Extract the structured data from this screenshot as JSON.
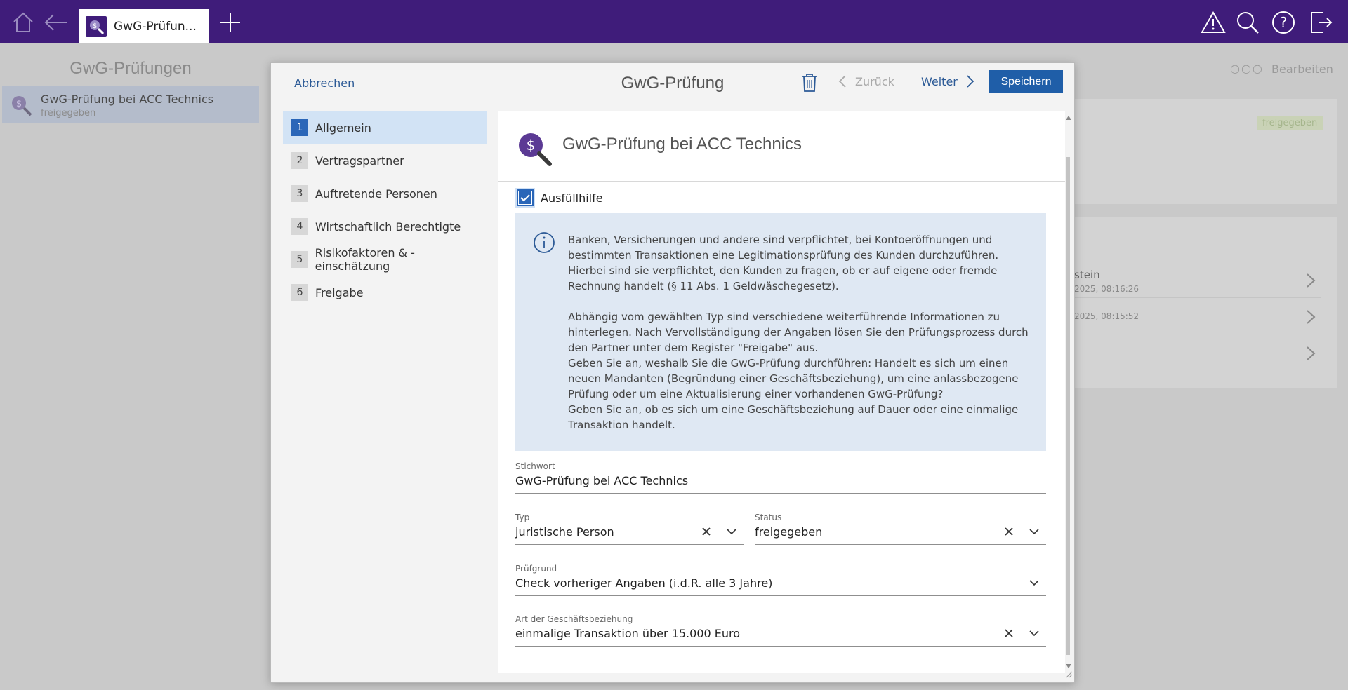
{
  "topbar": {
    "tab_label": "GwG-Prüfun...",
    "colors": {
      "bar": "#3f1c7a",
      "accent": "#1f5ea8"
    },
    "icons": [
      "home-icon",
      "back-arrow-icon",
      "plus-icon",
      "warning-icon",
      "search-icon",
      "help-icon",
      "logout-icon"
    ]
  },
  "background": {
    "list_title": "GwG-Prüfungen",
    "list_item": {
      "title": "GwG-Prüfung bei ACC Technics",
      "status": "freigegeben"
    },
    "edit_label": "Bearbeiten",
    "badge": "freigegeben",
    "rows": [
      {
        "title": "stein",
        "date": "2025, 08:16:26"
      },
      {
        "title": "",
        "date": "2025, 08:15:52"
      },
      {
        "title": "",
        "date": ""
      }
    ]
  },
  "modal": {
    "cancel_label": "Abbrechen",
    "title": "GwG-Prüfung",
    "back_label": "Zurück",
    "next_label": "Weiter",
    "save_label": "Speichern",
    "steps": [
      {
        "num": "1",
        "label": "Allgemein",
        "active": true
      },
      {
        "num": "2",
        "label": "Vertragspartner"
      },
      {
        "num": "3",
        "label": "Auftretende Personen"
      },
      {
        "num": "4",
        "label": "Wirtschaftlich Berechtigte"
      },
      {
        "num": "5",
        "label": "Risikofaktoren & -einschätzung"
      },
      {
        "num": "6",
        "label": "Freigabe"
      }
    ],
    "content_title": "GwG-Prüfung bei ACC Technics",
    "help_label": "Ausfüllhilfe",
    "info": {
      "p1": "Banken, Versicherungen und andere sind verpflichtet, bei Kontoeröffnungen und bestimmten Transaktionen eine Legitimationsprüfung des Kunden durchzuführen. Hierbei sind sie verpflichtet, den Kunden zu fragen, ob er auf eigene oder fremde Rechnung handelt (§ 11 Abs. 1 Geldwäschegesetz).",
      "p2": "Abhängig vom gewählten Typ sind verschiedene weiterführende Informationen zu hinterlegen. Nach Vervollständigung der Angaben lösen Sie den Prüfungsprozess durch den Partner unter dem Register \"Freigabe\" aus.",
      "p3": "Geben Sie an, weshalb Sie die GwG-Prüfung durchführen: Handelt es sich um einen neuen Mandanten (Begründung einer Geschäftsbeziehung), um eine anlassbezogene Prüfung oder um eine Aktualisierung einer vorhandenen GwG-Prüfung?",
      "p4": "Geben Sie an, ob es sich um eine Geschäftsbeziehung auf Dauer oder eine einmalige Transaktion handelt."
    },
    "fields": {
      "stichwort": {
        "label": "Stichwort",
        "value": "GwG-Prüfung bei ACC Technics"
      },
      "typ": {
        "label": "Typ",
        "value": "juristische Person"
      },
      "status": {
        "label": "Status",
        "value": "freigegeben"
      },
      "pruefgrund": {
        "label": "Prüfgrund",
        "value": "Check vorheriger Angaben (i.d.R. alle 3 Jahre)"
      },
      "art": {
        "label": "Art der Geschäftsbeziehung",
        "value": "einmalige Transaktion über 15.000 Euro"
      }
    }
  }
}
